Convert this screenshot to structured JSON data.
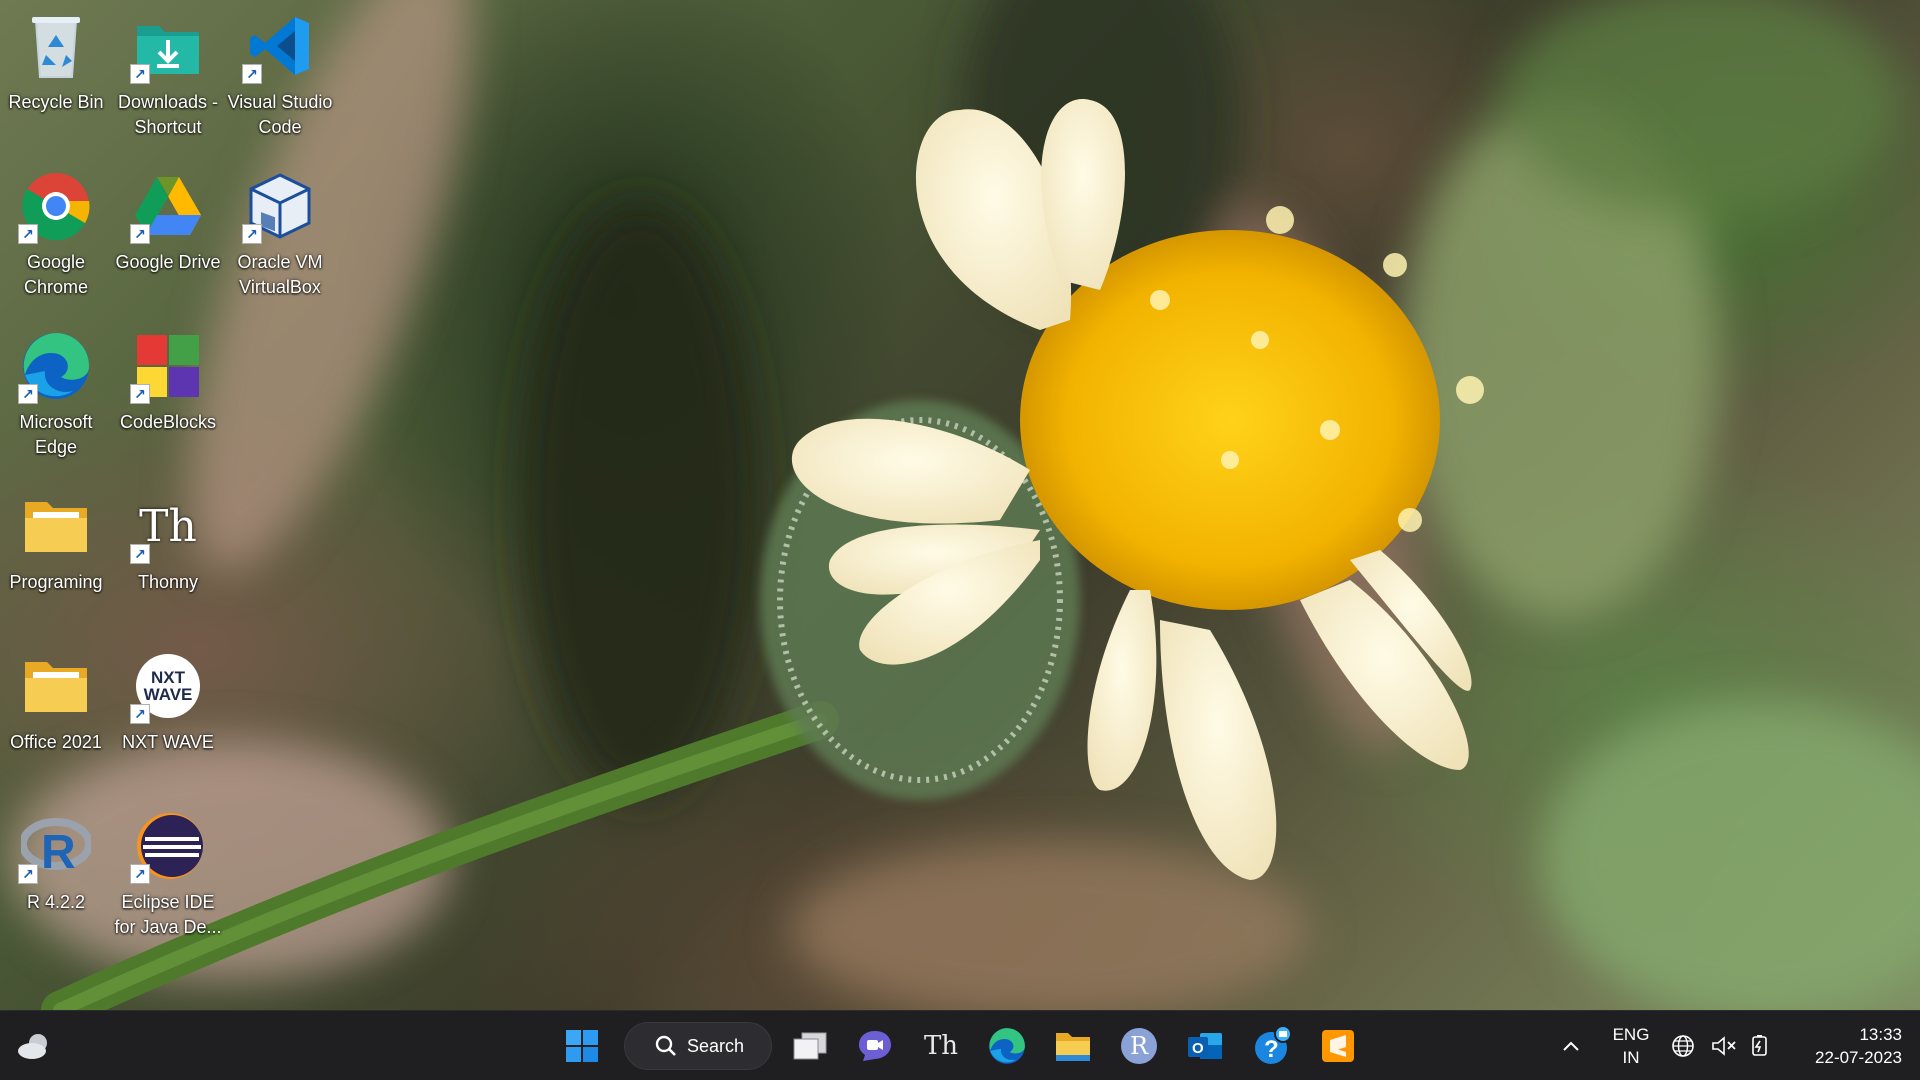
{
  "desktop": {
    "icons": [
      {
        "label": "Recycle Bin",
        "icon": "recycle-bin-icon",
        "shortcut": false
      },
      {
        "label": "Downloads - Shortcut",
        "icon": "downloads-folder-icon",
        "shortcut": true
      },
      {
        "label": "Visual Studio Code",
        "icon": "vscode-icon",
        "shortcut": true
      },
      {
        "label": "Google Chrome",
        "icon": "chrome-icon",
        "shortcut": true
      },
      {
        "label": "Google Drive",
        "icon": "google-drive-icon",
        "shortcut": true
      },
      {
        "label": "Oracle VM VirtualBox",
        "icon": "virtualbox-icon",
        "shortcut": true
      },
      {
        "label": "Microsoft Edge",
        "icon": "edge-icon",
        "shortcut": true
      },
      {
        "label": "CodeBlocks",
        "icon": "codeblocks-icon",
        "shortcut": true
      },
      {
        "label": "Programing",
        "icon": "folder-icon",
        "shortcut": false
      },
      {
        "label": "Thonny",
        "icon": "thonny-icon",
        "shortcut": true
      },
      {
        "label": "Office 2021",
        "icon": "folder-icon",
        "shortcut": false
      },
      {
        "label": "NXT WAVE",
        "icon": "nxtwave-icon",
        "shortcut": true
      },
      {
        "label": "R 4.2.2",
        "icon": "r-icon",
        "shortcut": true
      },
      {
        "label": "Eclipse IDE for Java De...",
        "icon": "eclipse-icon",
        "shortcut": true
      }
    ],
    "wallpaper": "flower-wallpaper"
  },
  "taskbar": {
    "weather_icon": "weather-cloud-icon",
    "start_icon": "windows-start-icon",
    "search_label": "Search",
    "thonny_glyph": "Th",
    "nxt_line1": "NXT",
    "nxt_line2": "WAVE",
    "r_letter": "R",
    "outlook_letter": "O",
    "pinned": [
      "task-view-icon",
      "teams-chat-icon",
      "thonny-icon",
      "edge-icon",
      "file-explorer-icon",
      "r-icon",
      "outlook-icon",
      "get-help-icon",
      "sublime-text-icon"
    ],
    "tray": {
      "chevron_icon": "chevron-up-icon",
      "language_line1": "ENG",
      "language_line2": "IN",
      "network_icon": "network-globe-icon",
      "volume_icon": "volume-muted-icon",
      "battery_icon": "battery-charging-icon",
      "time": "13:33",
      "date": "22-07-2023"
    }
  },
  "colors": {
    "taskbar_bg": "#1f1f22",
    "accent_blue": "#0078d4",
    "folder_yellow": "#f4c542"
  }
}
